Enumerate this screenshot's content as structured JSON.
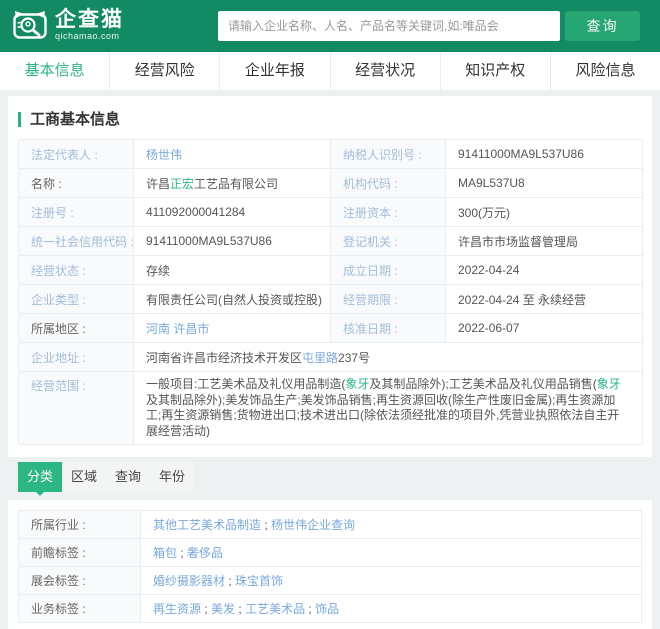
{
  "colors": {
    "header_green": "#128a63",
    "button_green": "#25a672",
    "active_green": "#2cb684",
    "link_blue": "#79a8dc",
    "label_blue": "#a3bcda",
    "highlight_green": "#2eb690"
  },
  "header": {
    "logo_title": "企查猫",
    "logo_domain": "qichamao.com",
    "search_placeholder": "请输入企业名称、人名、产品名等关键词,如:唯品会",
    "search_button": "查询"
  },
  "nav_tabs": [
    {
      "label": "基本信息",
      "active": true
    },
    {
      "label": "经营风险",
      "active": false
    },
    {
      "label": "企业年报",
      "active": false
    },
    {
      "label": "经营状况",
      "active": false
    },
    {
      "label": "知识产权",
      "active": false
    },
    {
      "label": "风险信息",
      "active": false
    }
  ],
  "section_title": "工商基本信息",
  "info": {
    "legal_rep": {
      "label": "法定代表人 :",
      "value": "杨世伟"
    },
    "taxpayer_id": {
      "label": "纳税人识别号 :",
      "value": "91411000MA9L537U86"
    },
    "name": {
      "label": "名称 :",
      "parts": [
        "许昌",
        "正宏",
        "工艺品有限公司"
      ]
    },
    "org_code": {
      "label": "机构代码 :",
      "value": "MA9L537U8"
    },
    "reg_no": {
      "label": "注册号 :",
      "value": "411092000041284"
    },
    "reg_capital": {
      "label": "注册资本 :",
      "value": "300(万元)"
    },
    "credit_code": {
      "label": "统一社会信用代码 :",
      "value": "91411000MA9L537U86"
    },
    "reg_authority": {
      "label": "登记机关 :",
      "value": "许昌市市场监督管理局"
    },
    "status": {
      "label": "经营状态 :",
      "value": "存续"
    },
    "est_date": {
      "label": "成立日期 :",
      "value": "2022-04-24"
    },
    "company_type": {
      "label": "企业类型 :",
      "value": "有限责任公司(自然人投资或控股)"
    },
    "term": {
      "label": "经营期限 :",
      "value": "2022-04-24 至 永续经营"
    },
    "region": {
      "label": "所属地区 :",
      "value": "河南 许昌市"
    },
    "approval_date": {
      "label": "核准日期 :",
      "value": "2022-06-07"
    },
    "address": {
      "label": "企业地址 :",
      "parts": [
        "河南省许昌市经济技术开发区",
        "屯里路",
        "237号"
      ]
    },
    "scope": {
      "label": "经营范围 :",
      "parts": [
        "一般项目:工艺美术品及礼仪用品制造(",
        "象牙",
        "及其制品除外);工艺美术品及礼仪用品销售(",
        "象牙",
        "及其制品除外);美发饰品生产;美发饰品销售;再生资源回收(除生产性废旧金属);再生资源加工;再生资源销售;货物进出口;技术进出口(除依法须经批准的项目外,凭营业执照依法自主开展经营活动)"
      ]
    }
  },
  "filter_tabs": [
    {
      "label": "分类",
      "active": true
    },
    {
      "label": "区域",
      "active": false
    },
    {
      "label": "查询",
      "active": false
    },
    {
      "label": "年份",
      "active": false
    }
  ],
  "tags": {
    "separator": " ; ",
    "industry": {
      "label": "所属行业 :",
      "links": [
        "其他工艺美术品制造",
        "杨世伟企业查询"
      ]
    },
    "foresight": {
      "label": "前瞻标签 :",
      "links": [
        "箱包",
        "奢侈品"
      ]
    },
    "exhibition": {
      "label": "展会标签 :",
      "links": [
        "婚纱摄影器材",
        "珠宝首饰"
      ]
    },
    "business": {
      "label": "业务标签 :",
      "links": [
        "再生资源",
        "美发",
        "工艺美术品",
        "饰品"
      ]
    }
  }
}
